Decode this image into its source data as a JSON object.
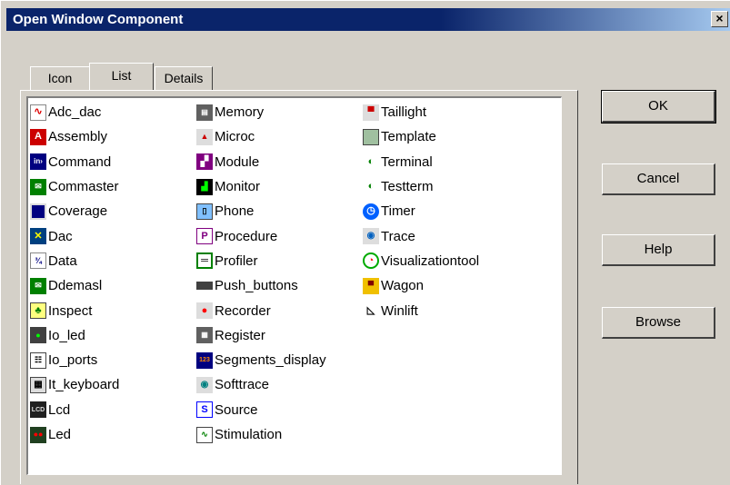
{
  "window": {
    "title": "Open Window Component",
    "close_label": "×"
  },
  "tabs": [
    {
      "label": "Icon",
      "active": false
    },
    {
      "label": "List",
      "active": true
    },
    {
      "label": "Details",
      "active": false
    }
  ],
  "columns": [
    [
      {
        "label": "Adc_dac",
        "icon": "adc-dac-icon"
      },
      {
        "label": "Assembly",
        "icon": "assembly-icon"
      },
      {
        "label": "Command",
        "icon": "command-icon"
      },
      {
        "label": "Commaster",
        "icon": "commaster-icon"
      },
      {
        "label": "Coverage",
        "icon": "coverage-icon"
      },
      {
        "label": "Dac",
        "icon": "dac-icon"
      },
      {
        "label": "Data",
        "icon": "data-icon"
      },
      {
        "label": "Ddemasl",
        "icon": "ddemasl-icon"
      },
      {
        "label": "Inspect",
        "icon": "inspect-icon"
      },
      {
        "label": "Io_led",
        "icon": "io-led-icon"
      },
      {
        "label": "Io_ports",
        "icon": "io-ports-icon"
      },
      {
        "label": "It_keyboard",
        "icon": "keyboard-icon"
      },
      {
        "label": "Lcd",
        "icon": "lcd-icon"
      },
      {
        "label": "Led",
        "icon": "led-icon"
      }
    ],
    [
      {
        "label": "Memory",
        "icon": "memory-icon"
      },
      {
        "label": "Microc",
        "icon": "microc-icon"
      },
      {
        "label": "Module",
        "icon": "module-icon"
      },
      {
        "label": "Monitor",
        "icon": "monitor-icon"
      },
      {
        "label": "Phone",
        "icon": "phone-icon"
      },
      {
        "label": "Procedure",
        "icon": "procedure-icon"
      },
      {
        "label": "Profiler",
        "icon": "profiler-icon"
      },
      {
        "label": "Push_buttons",
        "icon": "push-buttons-icon"
      },
      {
        "label": "Recorder",
        "icon": "recorder-icon"
      },
      {
        "label": "Register",
        "icon": "register-icon"
      },
      {
        "label": "Segments_display",
        "icon": "segments-display-icon"
      },
      {
        "label": "Softtrace",
        "icon": "softtrace-icon"
      },
      {
        "label": "Source",
        "icon": "source-icon"
      },
      {
        "label": "Stimulation",
        "icon": "stimulation-icon"
      }
    ],
    [
      {
        "label": "Taillight",
        "icon": "taillight-icon"
      },
      {
        "label": "Template",
        "icon": "template-icon"
      },
      {
        "label": "Terminal",
        "icon": "terminal-icon"
      },
      {
        "label": "Testterm",
        "icon": "testterm-icon"
      },
      {
        "label": "Timer",
        "icon": "timer-icon"
      },
      {
        "label": "Trace",
        "icon": "trace-icon"
      },
      {
        "label": "Visualizationtool",
        "icon": "visualizationtool-icon"
      },
      {
        "label": "Wagon",
        "icon": "wagon-icon"
      },
      {
        "label": "Winlift",
        "icon": "winlift-icon"
      }
    ]
  ],
  "buttons": {
    "ok": "OK",
    "cancel": "Cancel",
    "help": "Help",
    "browse": "Browse"
  }
}
